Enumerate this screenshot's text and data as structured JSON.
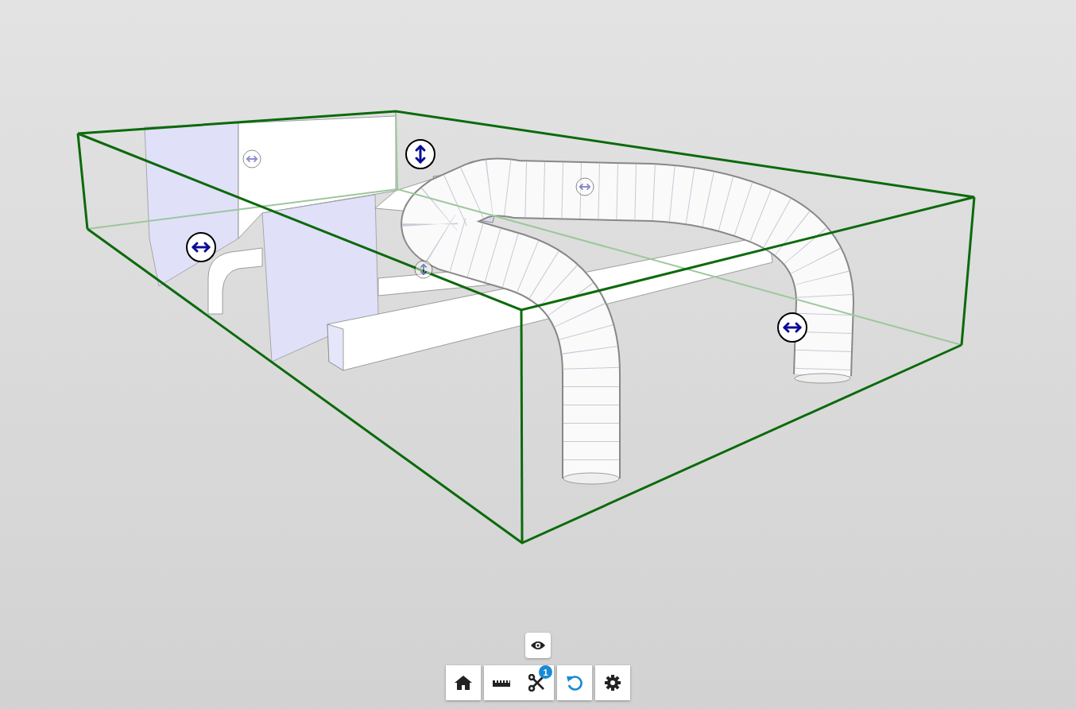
{
  "view_toggle": {
    "kind": "eye"
  },
  "toolbar": [
    {
      "tools": [
        {
          "kind": "home"
        }
      ]
    },
    {
      "tools": [
        {
          "kind": "measure"
        },
        {
          "kind": "section",
          "badge": "1"
        }
      ]
    },
    {
      "tools": [
        {
          "kind": "reset"
        }
      ]
    },
    {
      "tools": [
        {
          "kind": "settings"
        }
      ]
    }
  ]
}
